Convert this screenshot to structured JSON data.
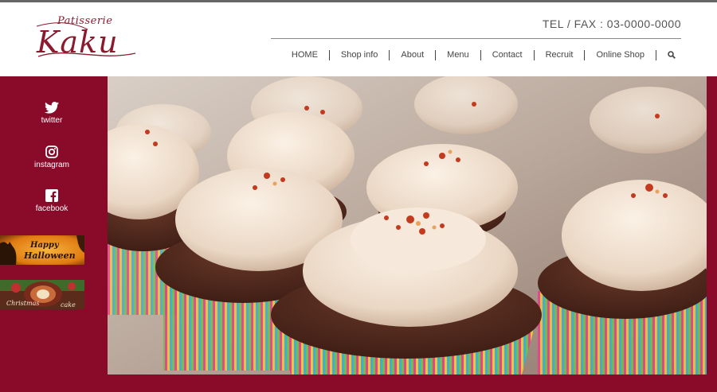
{
  "header": {
    "logo_top": "Patisserie",
    "logo_main": "Kaku",
    "tel": "TEL / FAX : 03-0000-0000"
  },
  "nav": {
    "items": [
      "HOME",
      "Shop info",
      "About",
      "Menu",
      "Contact",
      "Recruit",
      "Online Shop"
    ],
    "search_icon": "search-icon"
  },
  "sidebar": {
    "social": [
      {
        "label": "twitter",
        "icon": "twitter-icon"
      },
      {
        "label": "instagram",
        "icon": "instagram-icon"
      },
      {
        "label": "facebook",
        "icon": "facebook-icon"
      }
    ],
    "banners": [
      {
        "text": "Happy Halloween"
      },
      {
        "text_a": "Christmas",
        "text_b": "cake"
      }
    ]
  },
  "colors": {
    "brand": "#8a0a2a",
    "logo": "#8b1a2e",
    "text": "#444444"
  }
}
